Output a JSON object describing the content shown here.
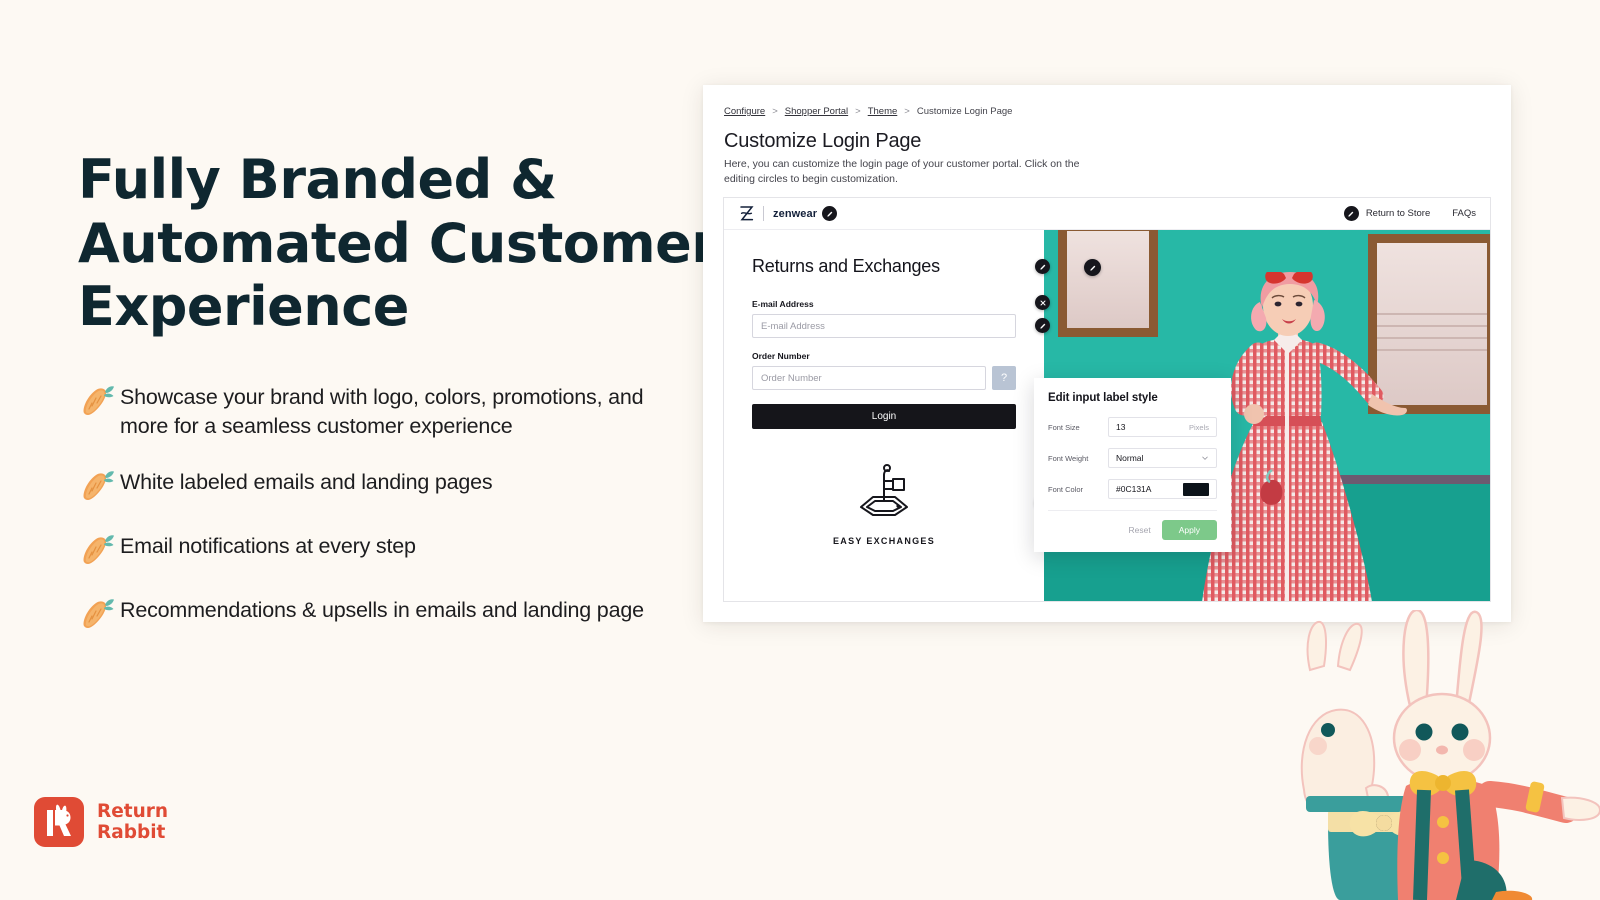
{
  "theme": {
    "background": "#fdf9f3",
    "headline_color": "#0f2730",
    "brand_red": "#e04b35",
    "apply_green": "#7dc98a",
    "portal_dark": "#15151a",
    "help_blue": "#b9c4d4"
  },
  "marketing": {
    "headline": "Fully Branded & Automated Customer Experience",
    "bullets": [
      {
        "icon": "carrot-icon",
        "text": "Showcase your brand with logo, colors, promotions, and more for a seamless customer experience"
      },
      {
        "icon": "carrot-icon",
        "text": "White labeled emails and landing pages"
      },
      {
        "icon": "carrot-icon",
        "text": "Email notifications at every step"
      },
      {
        "icon": "carrot-icon",
        "text": "Recommendations & upsells in emails and landing page"
      }
    ],
    "logo": {
      "line1": "Return",
      "line2": "Rabbit",
      "mark": "return-rabbit-r-icon"
    }
  },
  "app": {
    "breadcrumb": {
      "items": [
        "Configure",
        "Shopper Portal",
        "Theme"
      ],
      "separator": ">",
      "current": "Customize Login Page"
    },
    "page_title": "Customize Login Page",
    "page_subtitle": "Here, you can customize the login page of your customer portal. Click on the editing circles to begin customization.",
    "portal": {
      "header": {
        "logo_mark": "zenwear-z-icon",
        "brand_name": "zenwear",
        "links": [
          {
            "label": "Return to Store",
            "has_edit_badge": true
          },
          {
            "label": "FAQs",
            "has_edit_badge": false
          }
        ]
      },
      "form": {
        "title": "Returns and Exchanges",
        "email_label": "E-mail Address",
        "email_placeholder": "E-mail Address",
        "email_value": "",
        "order_label": "Order Number",
        "order_placeholder": "Order Number",
        "order_value": "",
        "help_glyph": "?",
        "login_label": "Login"
      },
      "promo": {
        "icon": "easy-exchanges-illustration",
        "label": "EASY EXCHANGES"
      },
      "photo_alt": "woman in red gingham dress by teal wall"
    },
    "style_panel": {
      "title": "Edit input label style",
      "fields": [
        {
          "label": "Font Size",
          "value": "13",
          "unit": "Pixels",
          "type": "number"
        },
        {
          "label": "Font Weight",
          "value": "Normal",
          "unit": "",
          "type": "select"
        },
        {
          "label": "Font Color",
          "value": "#0C131A",
          "unit": "",
          "type": "color",
          "swatch": "#0C131A"
        }
      ],
      "reset_label": "Reset",
      "apply_label": "Apply"
    }
  }
}
